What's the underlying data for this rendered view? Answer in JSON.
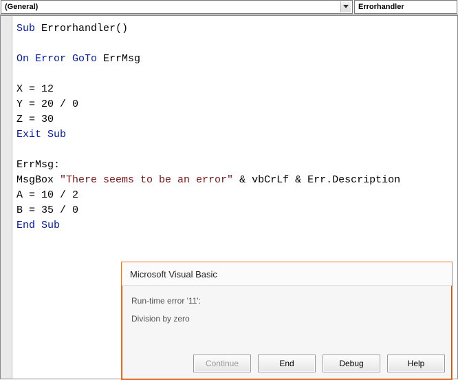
{
  "dropdowns": {
    "object_list": "(General)",
    "procedure_list": "Errorhandler"
  },
  "code": {
    "tokens": [
      {
        "kw": "Sub"
      },
      " Errorhandler()",
      "\n",
      "\n",
      {
        "kw": "On Error GoTo"
      },
      " ErrMsg",
      "\n",
      "\n",
      "X = 12",
      "\n",
      "Y = 20 / 0",
      "\n",
      "Z = 30",
      "\n",
      {
        "kw": "Exit Sub"
      },
      "\n",
      "\n",
      "ErrMsg:",
      "\n",
      "MsgBox ",
      {
        "str": "\"There seems to be an error\""
      },
      " & vbCrLf & Err.Description",
      "\n",
      "A = 10 / 2",
      "\n",
      "B = 35 / 0",
      "\n",
      {
        "kw": "End Sub"
      },
      "\n"
    ]
  },
  "dialog": {
    "title": "Microsoft Visual Basic",
    "error_line": "Run-time error '11':",
    "error_desc": "Division by zero",
    "buttons": {
      "continue": "Continue",
      "end": "End",
      "debug": "Debug",
      "help": "Help"
    }
  }
}
